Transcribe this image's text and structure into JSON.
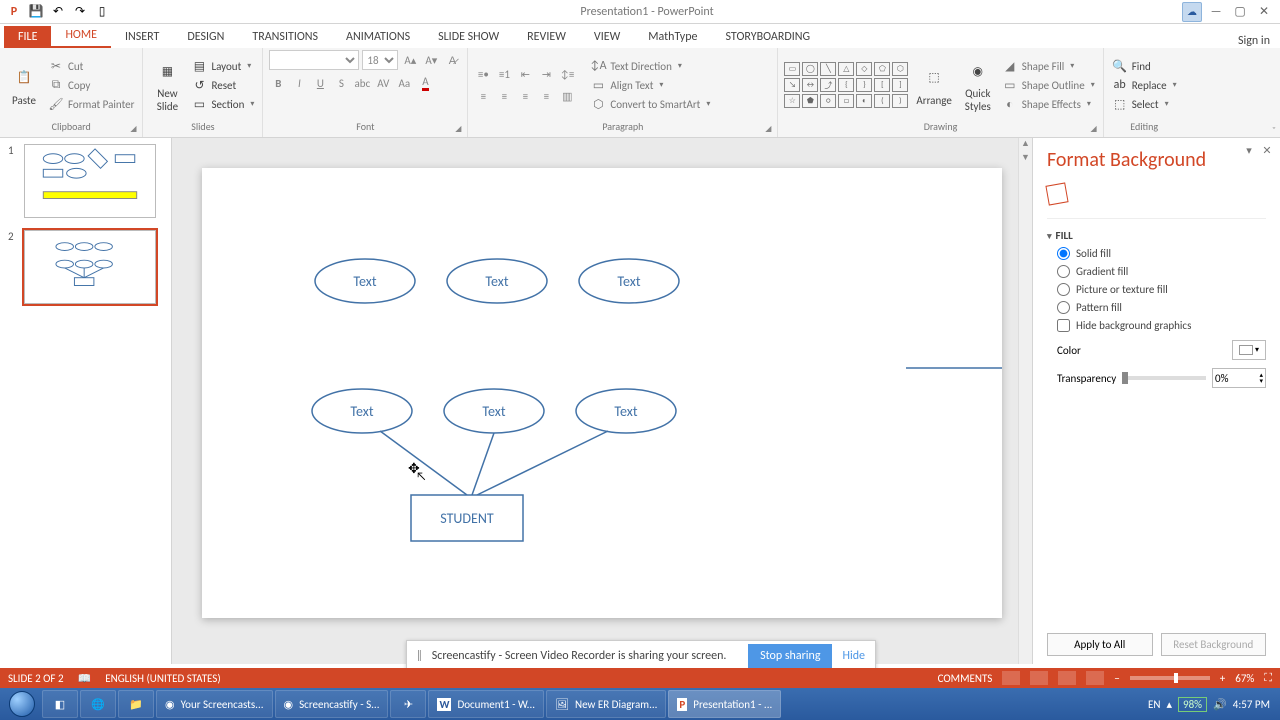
{
  "app": {
    "title": "Presentation1 - PowerPoint",
    "signin": "Sign in"
  },
  "tabs": {
    "file": "FILE",
    "home": "HOME",
    "insert": "INSERT",
    "design": "DESIGN",
    "transitions": "TRANSITIONS",
    "animations": "ANIMATIONS",
    "slideshow": "SLIDE SHOW",
    "review": "REVIEW",
    "view": "VIEW",
    "mathtype": "MathType",
    "storyboarding": "STORYBOARDING"
  },
  "ribbon": {
    "clipboard": {
      "label": "Clipboard",
      "paste": "Paste",
      "cut": "Cut",
      "copy": "Copy",
      "formatPainter": "Format Painter"
    },
    "slides": {
      "label": "Slides",
      "newSlide": "New\nSlide",
      "layout": "Layout",
      "reset": "Reset",
      "section": "Section"
    },
    "font": {
      "label": "Font",
      "size": "18"
    },
    "paragraph": {
      "label": "Paragraph",
      "textDirection": "Text Direction",
      "alignText": "Align Text",
      "convert": "Convert to SmartArt"
    },
    "drawing": {
      "label": "Drawing",
      "arrange": "Arrange",
      "quickStyles": "Quick\nStyles",
      "shapeFill": "Shape Fill",
      "shapeOutline": "Shape Outline",
      "shapeEffects": "Shape Effects"
    },
    "editing": {
      "label": "Editing",
      "find": "Find",
      "replace": "Replace",
      "select": "Select"
    }
  },
  "thumbs": {
    "n1": "1",
    "n2": "2"
  },
  "slide": {
    "oval1": "Text",
    "oval2": "Text",
    "oval3": "Text",
    "oval4": "Text",
    "oval5": "Text",
    "oval6": "Text",
    "rect": "STUDENT"
  },
  "fmt": {
    "title": "Format Background",
    "fillHdr": "FILL",
    "solid": "Solid fill",
    "gradient": "Gradient fill",
    "picture": "Picture or texture fill",
    "pattern": "Pattern fill",
    "hideBg": "Hide background graphics",
    "color": "Color",
    "transparency": "Transparency",
    "transVal": "0%",
    "applyAll": "Apply to All",
    "reset": "Reset Background"
  },
  "share": {
    "msg": "Screencastify - Screen Video Recorder is sharing your screen.",
    "stop": "Stop sharing",
    "hide": "Hide"
  },
  "status": {
    "slide": "SLIDE 2 OF 2",
    "lang": "ENGLISH (UNITED STATES)",
    "comments": "COMMENTS",
    "zoom": "67%"
  },
  "taskbar": {
    "t1": "Your Screencasts...",
    "t2": "Screencastify - S...",
    "t3": "Document1 - W...",
    "t4": "New ER Diagram...",
    "t5": "Presentation1 - ...",
    "lang": "EN",
    "battery": "98%",
    "time": "4:57 PM"
  }
}
